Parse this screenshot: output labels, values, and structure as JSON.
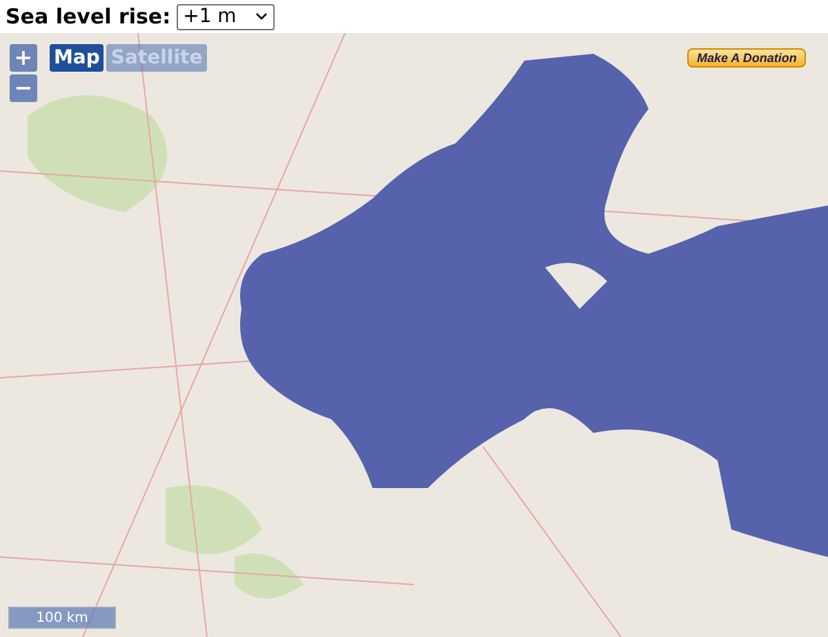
{
  "sea_level": {
    "label": "Sea level rise:",
    "value": "+1 m"
  },
  "zoom": {
    "zoom_in": "+",
    "zoom_out": "−"
  },
  "map_types": [
    {
      "label": "Map",
      "selected": true
    },
    {
      "label": "Satellite",
      "selected": false
    }
  ],
  "donate_button": {
    "label": "Make A Donation"
  },
  "scale": {
    "label": "100 km"
  }
}
